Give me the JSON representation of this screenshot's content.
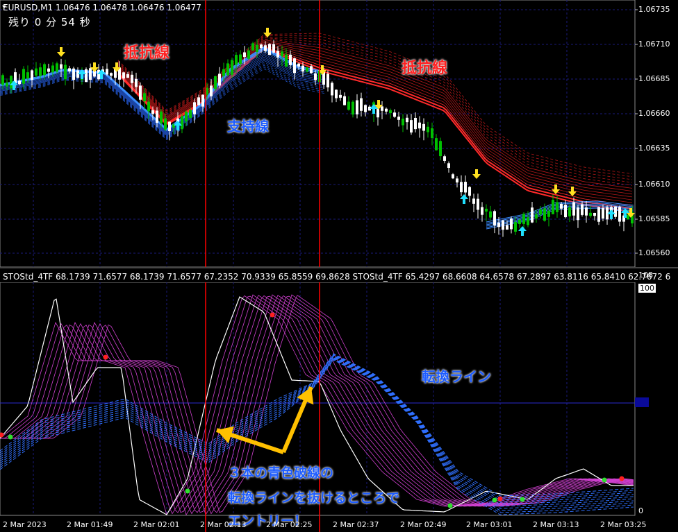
{
  "symbol_info": "EURUSD,M1  1.06476 1.06478 1.06476 1.06477",
  "timer": "残り 0 分 54 秒",
  "indicator_label": "STOStd_4TF 68.1739 71.6577 68.1739 71.6577 67.2352 70.9339 65.8559 69.8628  STOStd_4TF 65.4297 68.6608 64.6578 67.2897 63.8116 65.8410 62.7672 6",
  "price_axis": [
    "1.06735",
    "1.06710",
    "1.06685",
    "1.06660",
    "1.06635",
    "1.06610",
    "1.06585",
    "1.06560"
  ],
  "indicator_axis": {
    "top": "108",
    "hundred": "100",
    "zero": "0"
  },
  "time_axis": [
    "2 Mar 2023",
    "2 Mar 01:49",
    "2 Mar 02:01",
    "2 Mar 02:13",
    "2 Mar 02:25",
    "2 Mar 02:37",
    "2 Mar 02:49",
    "2 Mar 03:01",
    "2 Mar 03:13",
    "2 Mar 03:25"
  ],
  "annotations": {
    "resistance_left": "抵抗線",
    "resistance_right": "抵抗線",
    "support": "支持線",
    "switch_line": "転換ライン",
    "entry_line1": "３本の青色破線の",
    "entry_line2": "転換ラインを抜けるところで",
    "entry_line3": "エントリー！"
  },
  "colors": {
    "bull_candle": "#00c000",
    "bear_candle": "#ffffff",
    "resistance_ribbon": "#ff2a2a",
    "support_ribbon": "#3a8cff",
    "stoch_ribbon": "#d040d0",
    "stoch_blue": "#3070ff",
    "vertical_marker": "#ff0000",
    "arrow_up": "#20e0ff",
    "arrow_down": "#ffe020",
    "callout_arrow": "#ffc000"
  }
}
